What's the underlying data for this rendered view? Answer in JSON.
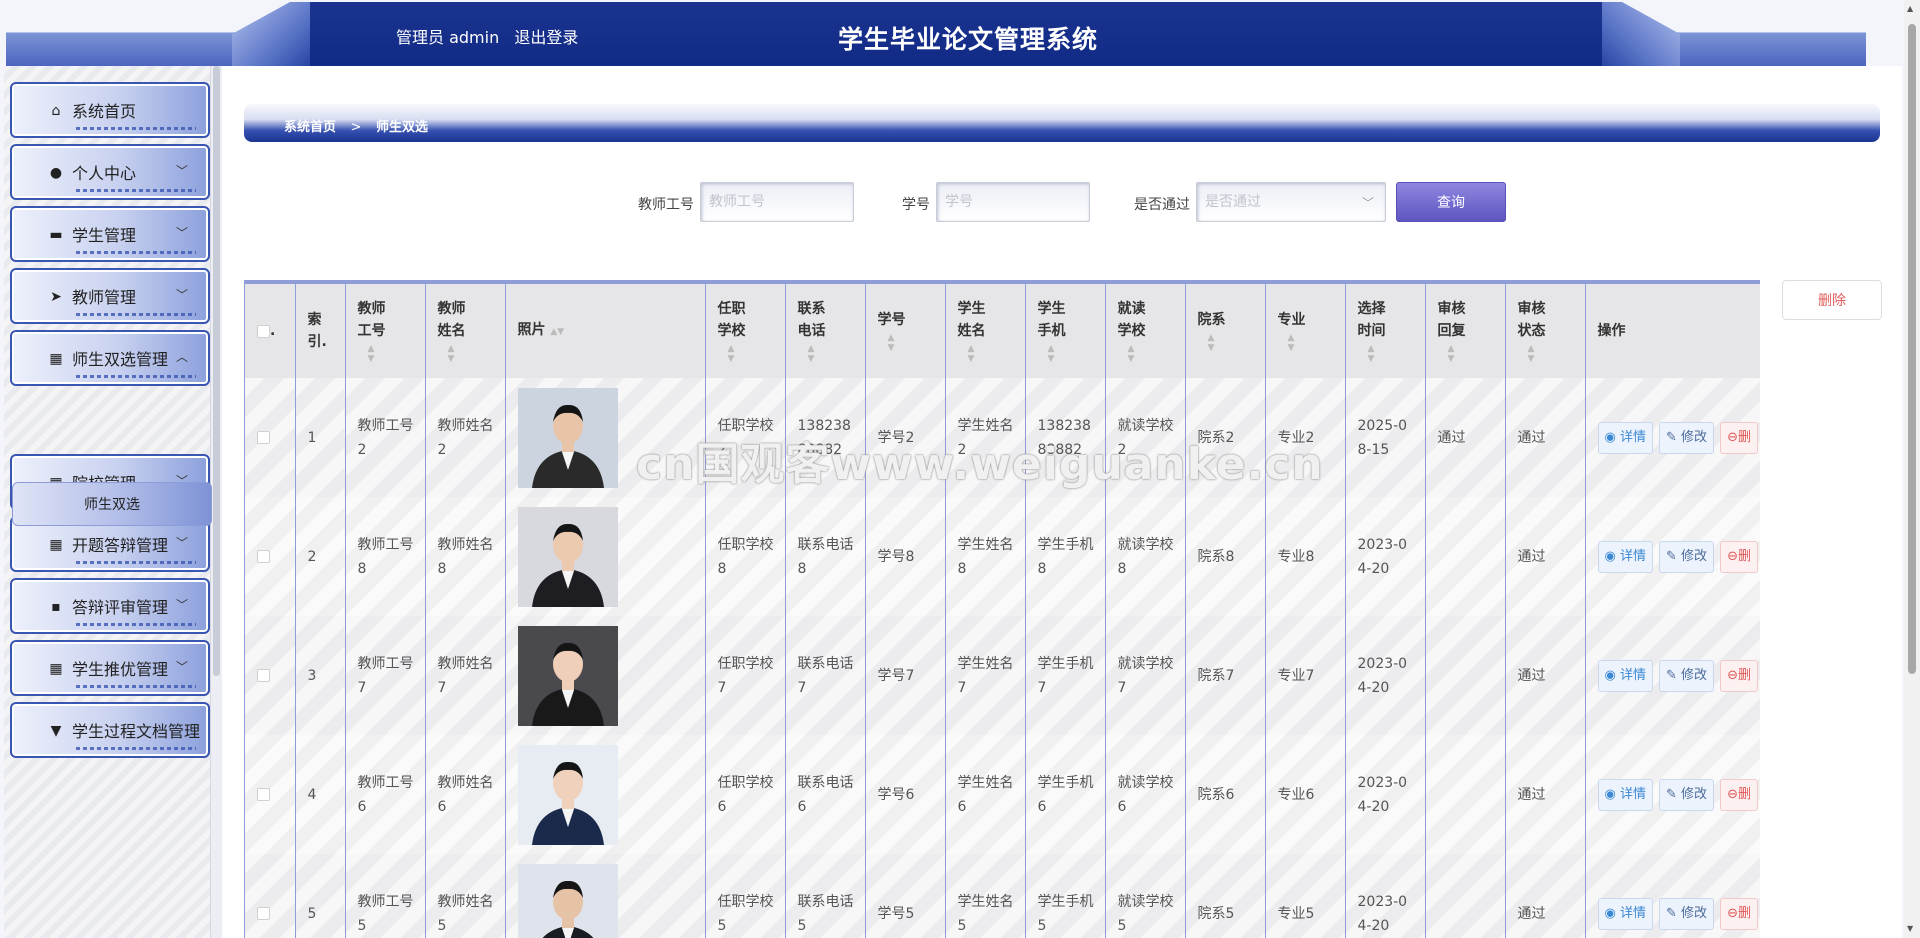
{
  "header": {
    "admin_label": "管理员 admin",
    "logout_label": "退出登录",
    "title": "学生毕业论文管理系统"
  },
  "sidebar": {
    "items": [
      {
        "label": "系统首页",
        "icon": "home-icon",
        "caret": ""
      },
      {
        "label": "个人中心",
        "icon": "user-icon",
        "caret": "﹀"
      },
      {
        "label": "学生管理",
        "icon": "monitor-icon",
        "caret": "﹀"
      },
      {
        "label": "教师管理",
        "icon": "send-icon",
        "caret": "﹀"
      },
      {
        "label": "师生双选管理",
        "icon": "grid-icon",
        "caret": "︿"
      },
      {
        "label": "院校管理",
        "icon": "grid-icon",
        "caret": "﹀"
      },
      {
        "label": "开题答辩管理",
        "icon": "grid-icon",
        "caret": "﹀"
      },
      {
        "label": "答辩评审管理",
        "icon": "chat-icon",
        "caret": "﹀"
      },
      {
        "label": "学生推优管理",
        "icon": "grid-icon",
        "caret": "﹀"
      },
      {
        "label": "学生过程文档管理",
        "icon": "folder-icon",
        "caret": ""
      }
    ],
    "sub_item": "师生双选"
  },
  "breadcrumb": {
    "home": "系统首页",
    "separator": ">",
    "current": "师生双选"
  },
  "search": {
    "teacher_id_label": "教师工号",
    "teacher_id_placeholder": "教师工号",
    "student_id_label": "学号",
    "student_id_placeholder": "学号",
    "passed_label": "是否通过",
    "passed_placeholder": "是否通过",
    "query_button": "查询"
  },
  "delete_button": "删除",
  "table": {
    "headers": {
      "index": "索\n引.",
      "teacher_id": "教师\n工号",
      "teacher_name": "教师\n姓名",
      "photo": "照片",
      "school": "任职\n学校",
      "phone": "联系\n电话",
      "student_id": "学号",
      "student_name": "学生\n姓名",
      "student_phone": "学生\n手机",
      "student_school": "就读\n学校",
      "department": "院系",
      "major": "专业",
      "select_time": "选择\n时间",
      "review_reply": "审核\n回复",
      "review_status": "审核\n状态",
      "actions": "操作"
    },
    "action_labels": {
      "detail": "详情",
      "edit": "修改",
      "delete": "删"
    },
    "rows": [
      {
        "index": "1",
        "teacher_id": "教师工号2",
        "teacher_name": "教师姓名2",
        "school": "任职学校2",
        "phone": "13823888882",
        "student_id": "学号2",
        "student_name": "学生姓名2",
        "student_phone": "13823888882",
        "student_school": "就读学校2",
        "department": "院系2",
        "major": "专业2",
        "select_time": "2025-08-15",
        "review_reply": "通过",
        "review_status": "通过"
      },
      {
        "index": "2",
        "teacher_id": "教师工号8",
        "teacher_name": "教师姓名8",
        "school": "任职学校8",
        "phone": "联系电话8",
        "student_id": "学号8",
        "student_name": "学生姓名8",
        "student_phone": "学生手机8",
        "student_school": "就读学校8",
        "department": "院系8",
        "major": "专业8",
        "select_time": "2023-04-20",
        "review_reply": "",
        "review_status": "通过"
      },
      {
        "index": "3",
        "teacher_id": "教师工号7",
        "teacher_name": "教师姓名7",
        "school": "任职学校7",
        "phone": "联系电话7",
        "student_id": "学号7",
        "student_name": "学生姓名7",
        "student_phone": "学生手机7",
        "student_school": "就读学校7",
        "department": "院系7",
        "major": "专业7",
        "select_time": "2023-04-20",
        "review_reply": "",
        "review_status": "通过"
      },
      {
        "index": "4",
        "teacher_id": "教师工号6",
        "teacher_name": "教师姓名6",
        "school": "任职学校6",
        "phone": "联系电话6",
        "student_id": "学号6",
        "student_name": "学生姓名6",
        "student_phone": "学生手机6",
        "student_school": "就读学校6",
        "department": "院系6",
        "major": "专业6",
        "select_time": "2023-04-20",
        "review_reply": "",
        "review_status": "通过"
      },
      {
        "index": "5",
        "teacher_id": "教师工号5",
        "teacher_name": "教师姓名5",
        "school": "任职学校5",
        "phone": "联系电话5",
        "student_id": "学号5",
        "student_name": "学生姓名5",
        "student_phone": "学生手机5",
        "student_school": "就读学校5",
        "department": "院系5",
        "major": "专业5",
        "select_time": "2023-04-20",
        "review_reply": "",
        "review_status": "通过"
      }
    ]
  },
  "watermark": "cn国观客www.weiguanke.cn",
  "colors": {
    "header_dark": "#102a86",
    "accent": "#3a56b3",
    "query_button": "#6a60c8",
    "delete_text": "#e25b5b"
  }
}
